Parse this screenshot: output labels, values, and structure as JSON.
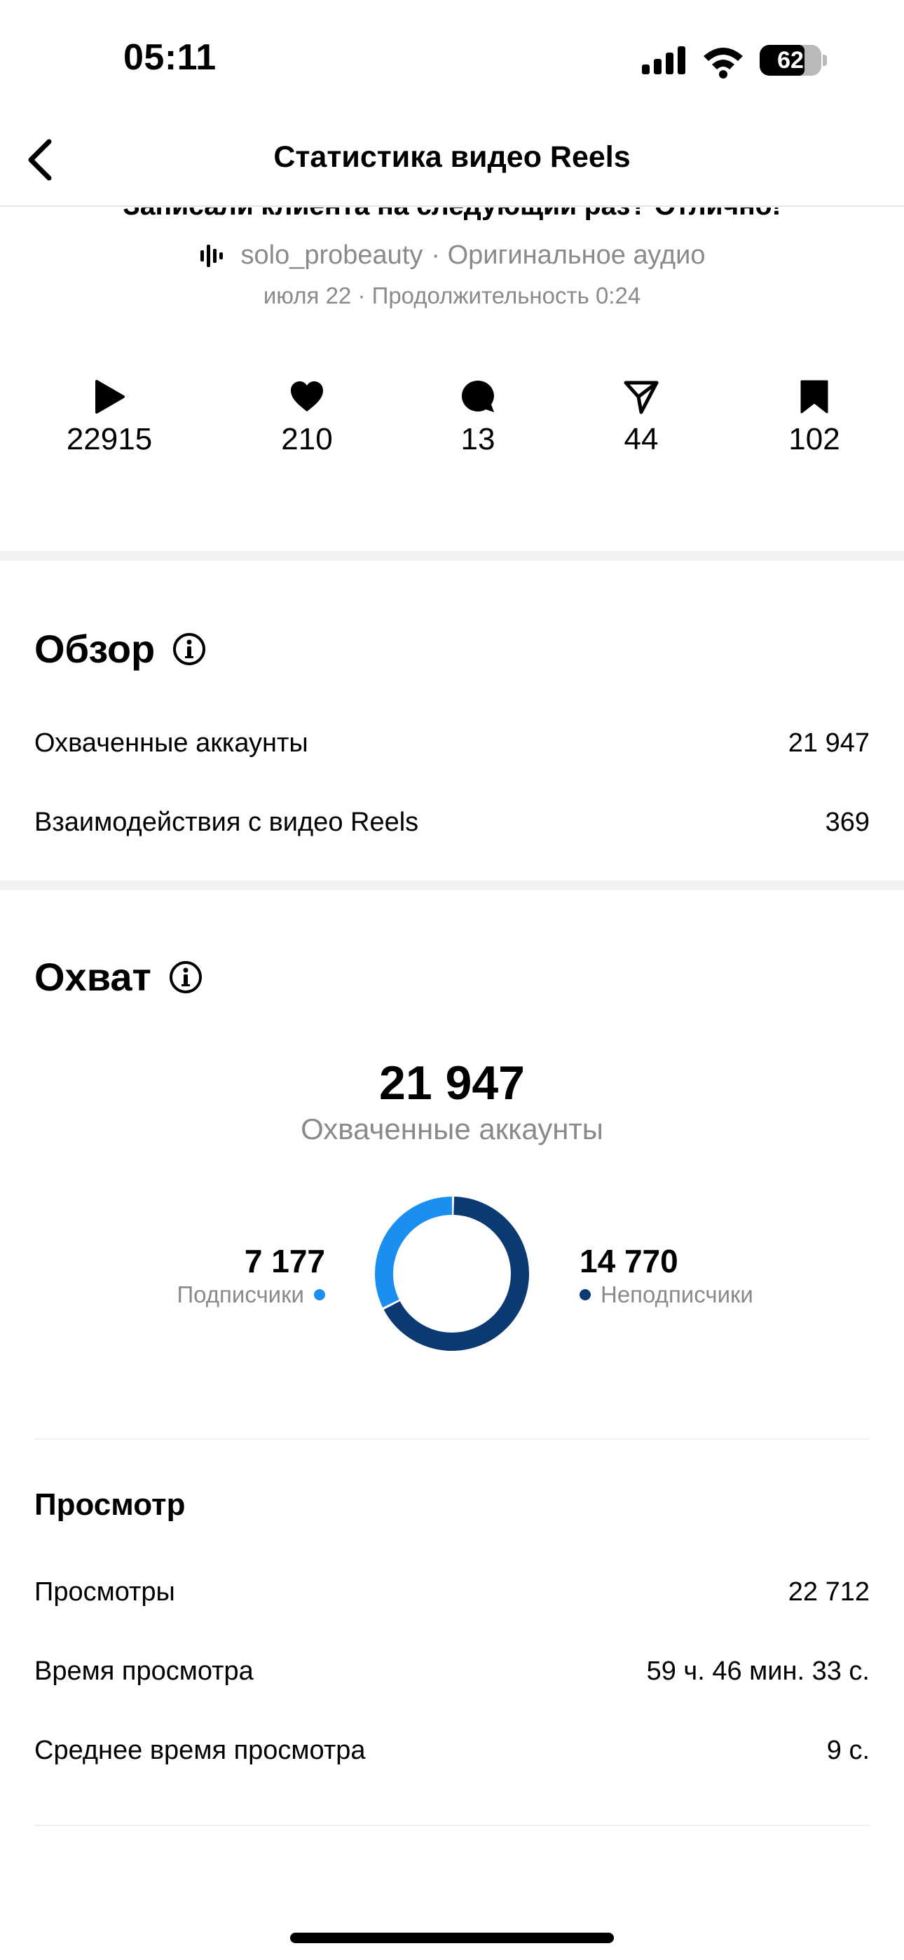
{
  "status_bar": {
    "time": "05:11",
    "battery": "62"
  },
  "header": {
    "title": "Статистика видео Reels"
  },
  "reel": {
    "caption": "Записали клиента на следующий раз? Отлично!",
    "username": "solo_probeauty",
    "audio": "· Оригинальное аудио",
    "meta": "июля 22 · Продолжительность 0:24"
  },
  "stats": [
    {
      "icon": "play-icon",
      "value": "22915"
    },
    {
      "icon": "heart-icon",
      "value": "210"
    },
    {
      "icon": "comment-icon",
      "value": "13"
    },
    {
      "icon": "share-icon",
      "value": "44"
    },
    {
      "icon": "bookmark-icon",
      "value": "102"
    }
  ],
  "overview": {
    "title": "Обзор",
    "rows": [
      {
        "label": "Охваченные аккаунты",
        "value": "21 947"
      },
      {
        "label": "Взаимодействия с видео Reels",
        "value": "369"
      }
    ]
  },
  "reach": {
    "title": "Охват",
    "total": "21 947",
    "total_label": "Охваченные аккаунты",
    "followers": {
      "value": "7 177",
      "label": "Подписчики",
      "color": "#1a8ff0"
    },
    "non_followers": {
      "value": "14 770",
      "label": "Неподписчики",
      "color": "#0b3a73"
    }
  },
  "chart_data": {
    "type": "pie",
    "categories": [
      "Подписчики",
      "Неподписчики"
    ],
    "values": [
      7177,
      14770
    ],
    "colors": [
      "#1a8ff0",
      "#0b3a73"
    ],
    "donut": true
  },
  "views": {
    "title": "Просмотр",
    "rows": [
      {
        "label": "Просмотры",
        "value": "22 712"
      },
      {
        "label": "Время просмотра",
        "value": "59 ч. 46 мин. 33 с."
      },
      {
        "label": "Среднее время просмотра",
        "value": "9 с."
      }
    ]
  }
}
